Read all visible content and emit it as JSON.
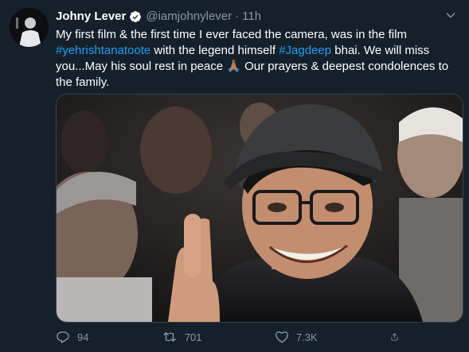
{
  "tweet": {
    "author_name": "Johny Lever",
    "handle": "@iamjohnylever",
    "separator": "·",
    "time": "11h",
    "text_1": "My first film & the first time I ever faced the camera, was in the film",
    "hashtag_1": "#yehrishtanatoote",
    "text_2": " with the legend himself ",
    "hashtag_2": "#Jagdeep",
    "text_3": " bhai. We will miss you...May his soul rest in peace 🙏🏽 Our prayers & deepest condolences to the family."
  },
  "actions": {
    "reply_count": "94",
    "retweet_count": "701",
    "like_count": "7.3K"
  },
  "icons": {
    "verified": "verified-badge-icon",
    "more": "chevron-down-icon",
    "reply": "reply-icon",
    "retweet": "retweet-icon",
    "like": "heart-icon",
    "share": "share-icon"
  },
  "colors": {
    "background": "#15202b",
    "accent": "#1da1f2",
    "muted": "#8899a6"
  }
}
